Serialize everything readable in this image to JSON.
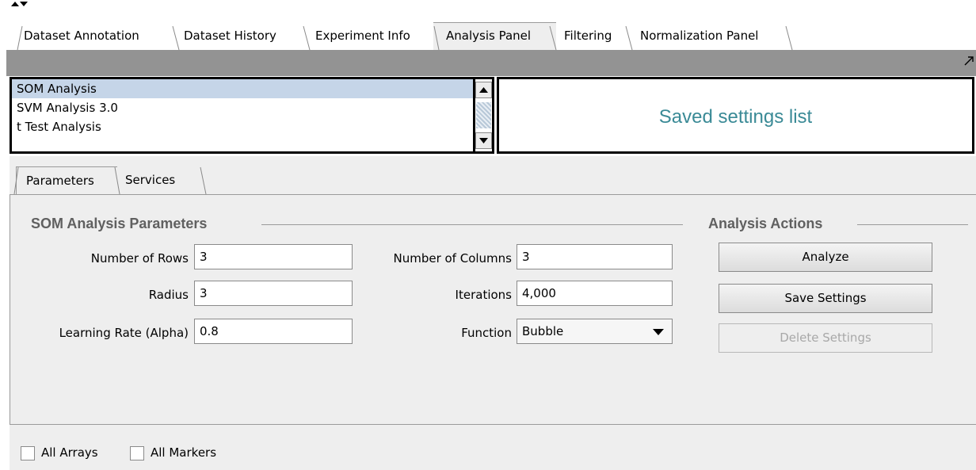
{
  "top_tabs": [
    {
      "label": "Dataset Annotation"
    },
    {
      "label": "Dataset History"
    },
    {
      "label": "Experiment Info"
    },
    {
      "label": "Analysis Panel",
      "active": true
    },
    {
      "label": "Filtering"
    },
    {
      "label": "Normalization Panel"
    }
  ],
  "component_list": {
    "items": [
      "SOM Analysis",
      "SVM Analysis 3.0",
      "t Test Analysis"
    ],
    "selected": "SOM Analysis"
  },
  "saved_settings": {
    "label": "Saved settings list"
  },
  "sub_tabs": [
    {
      "label": "Parameters",
      "active": true
    },
    {
      "label": "Services"
    }
  ],
  "parameters": {
    "group_title": "SOM Analysis Parameters",
    "rows_label": "Number of Rows",
    "rows_value": "3",
    "columns_label": "Number of Columns",
    "columns_value": "3",
    "radius_label": "Radius",
    "radius_value": "3",
    "iterations_label": "Iterations",
    "iterations_value": "4,000",
    "alpha_label": "Learning Rate (Alpha)",
    "alpha_value": "0.8",
    "function_label": "Function",
    "function_value": "Bubble"
  },
  "actions": {
    "group_title": "Analysis Actions",
    "analyze": "Analyze",
    "save": "Save Settings",
    "delete": "Delete Settings"
  },
  "bottom": {
    "all_arrays": "All Arrays",
    "all_markers": "All Markers"
  },
  "colors": {
    "saved_label": "#3a8a96",
    "selection": "#c5d5e8",
    "strip": "#939393",
    "panel_bg": "#eeeeee"
  }
}
